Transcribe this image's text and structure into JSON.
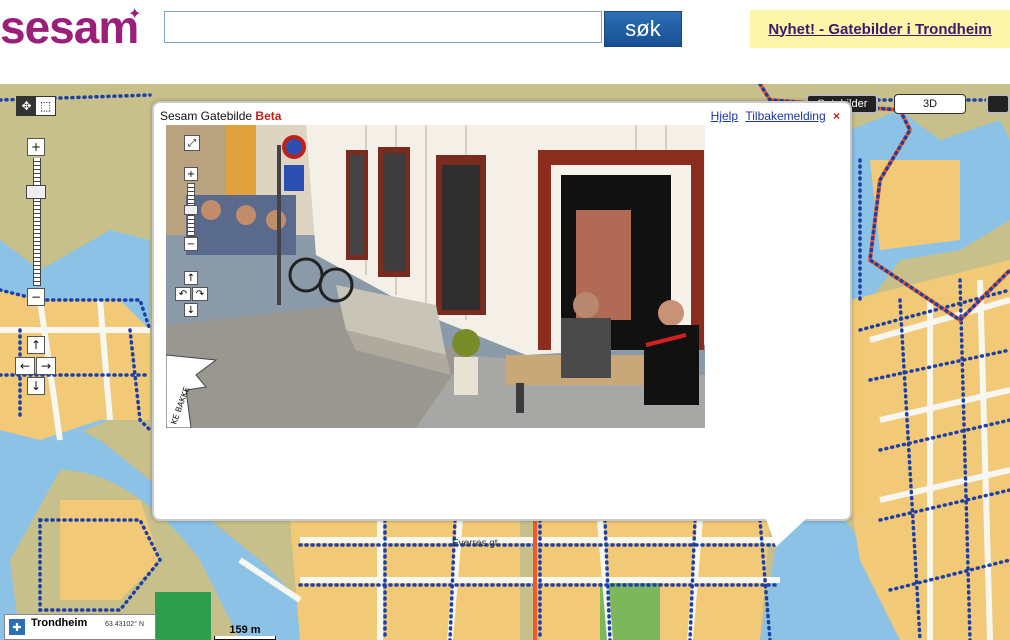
{
  "header": {
    "logo_text": "sesam",
    "search": {
      "value": "",
      "placeholder": ""
    },
    "search_button_label": "søk",
    "news_link": "Nyhet! - Gatebilder i Trondheim"
  },
  "map": {
    "tabs": [
      {
        "label": "Gatebilder",
        "active": true
      },
      {
        "label": "3D",
        "active": false
      }
    ],
    "zoom_in": "+",
    "zoom_out": "−",
    "pan": {
      "up": "↑",
      "down": "↓",
      "left": "←",
      "right": "→"
    },
    "labels": [
      "Everres gt"
    ],
    "location": {
      "name": "Trondheim",
      "coord": "63.43102° N"
    },
    "scale": "159 m",
    "colors": {
      "water": "#8bc2e6",
      "land": "#c8c08a",
      "urban": "#f2c977",
      "road": "#f7f7f2",
      "route": "#1c3fa8",
      "highlight": "#f05a28",
      "park": "#2e9e4e"
    }
  },
  "popup": {
    "title": "Sesam Gatebilde",
    "badge": "Beta",
    "links": {
      "help": "Hjelp",
      "feedback": "Tilbakemelding"
    },
    "close": "×",
    "photo_controls": {
      "expand": "⤢",
      "zoom_in": "+",
      "zoom_out": "−",
      "up": "↑",
      "down": "↓",
      "left": "↶",
      "right": "↷"
    },
    "map_street_fragment": "KE BAKKE"
  }
}
